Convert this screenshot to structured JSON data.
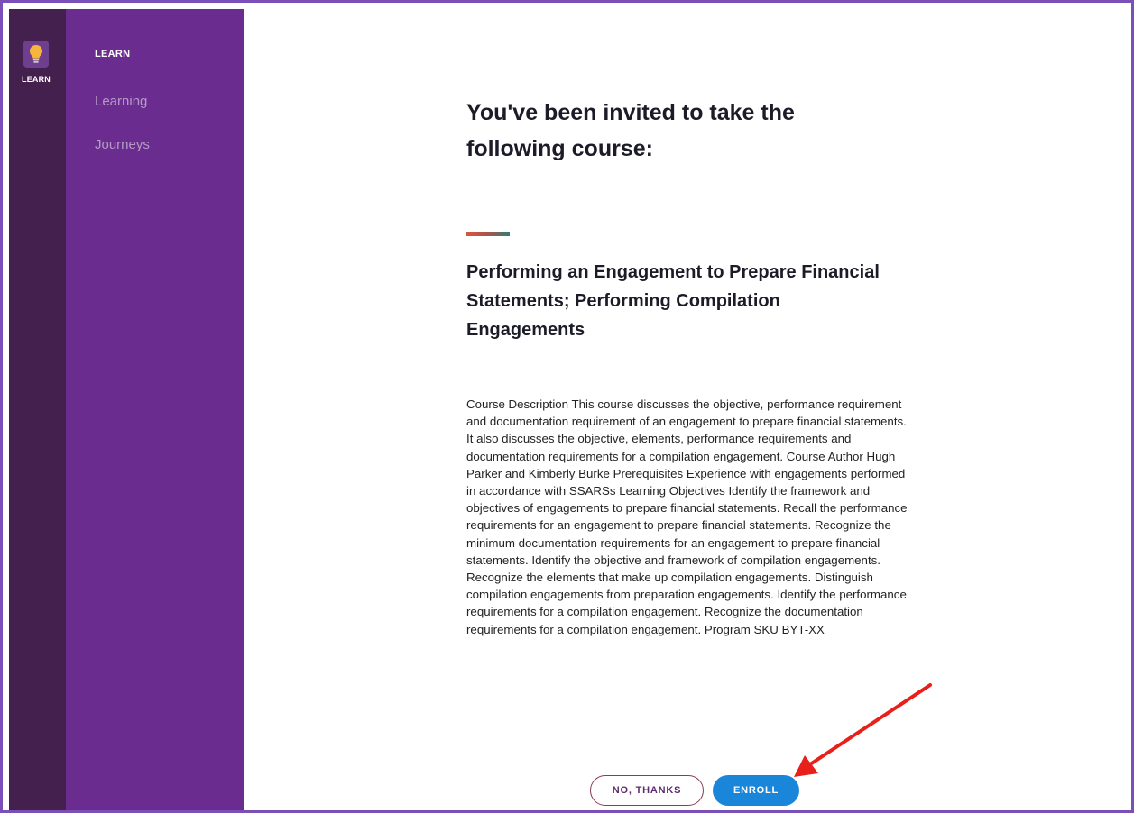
{
  "rail": {
    "items": [
      {
        "label": "LEARN",
        "icon": "lightbulb-icon"
      }
    ]
  },
  "subnav": {
    "heading": "LEARN",
    "links": [
      "Learning",
      "Journeys"
    ]
  },
  "main": {
    "invite_heading": "You've been invited to take the following course:",
    "course_title": "Performing an Engagement to Prepare Financial Statements; Performing Compilation Engagements",
    "course_description": "Course Description This course discusses the objective, performance requirement and documentation requirement of an engagement to prepare financial statements. It also discusses the objective, elements, performance requirements and documentation requirements for a compilation engagement. Course Author Hugh Parker and Kimberly Burke Prerequisites Experience with engagements performed in accordance with SSARSs Learning Objectives Identify the framework and objectives of engagements to prepare financial statements. Recall the performance requirements for an engagement to prepare financial statements. Recognize the minimum documentation requirements for an engagement to prepare financial statements. Identify the objective and framework of compilation engagements. Recognize the elements that make up compilation engagements. Distinguish compilation engagements from preparation engagements. Identify the performance requirements for a compilation engagement. Recognize the documentation requirements for a compilation engagement. Program SKU BYT-XX",
    "buttons": {
      "decline": "NO, THANKS",
      "enroll": "ENROLL"
    }
  },
  "colors": {
    "rail_bg": "#44204f",
    "subnav_bg": "#6b2c8f",
    "enroll_bg": "#1a86d9",
    "annotation": "#e8201a"
  }
}
